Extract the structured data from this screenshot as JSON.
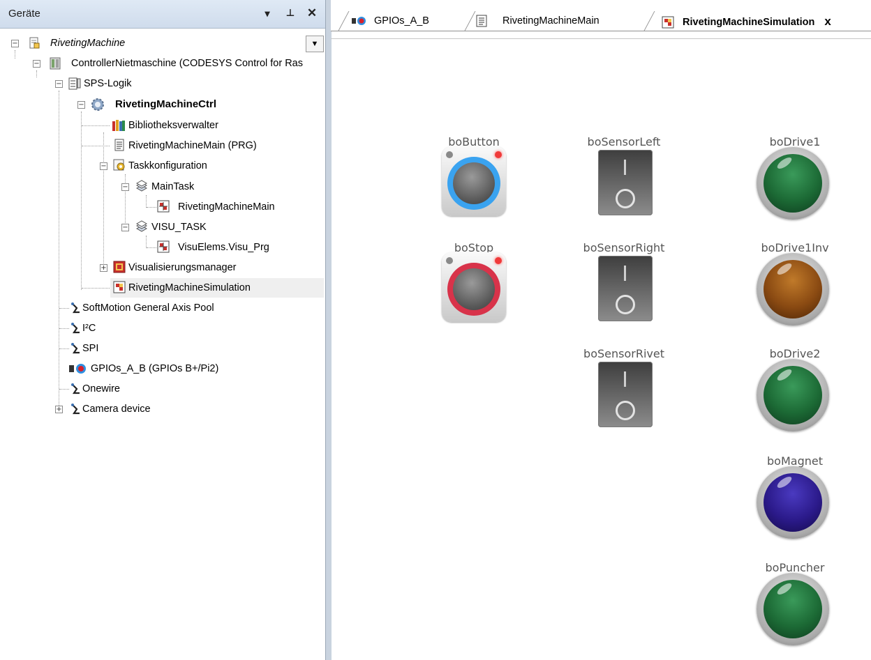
{
  "devices_panel": {
    "title": "Geräte",
    "pin_glyph": "ᵖ",
    "close_glyph": "✕",
    "dropdown_glyph": "▾"
  },
  "tree": {
    "items": [
      {
        "label": "RivetingMachine",
        "icon": "project-icon"
      },
      {
        "label": "ControllerNietmaschine (CODESYS Control for Ras",
        "icon": "controller-icon"
      },
      {
        "label": "SPS-Logik",
        "icon": "plc-logic-icon"
      },
      {
        "label": "RivetingMachineCtrl",
        "icon": "application-gear-icon"
      },
      {
        "label": "Bibliotheksverwalter",
        "icon": "library-icon"
      },
      {
        "label": "RivetingMachineMain (PRG)",
        "icon": "program-icon"
      },
      {
        "label": "Taskkonfiguration",
        "icon": "task-config-icon"
      },
      {
        "label": "MainTask",
        "icon": "task-icon"
      },
      {
        "label": "RivetingMachineMain",
        "icon": "task-call-icon"
      },
      {
        "label": "VISU_TASK",
        "icon": "task-icon"
      },
      {
        "label": "VisuElems.Visu_Prg",
        "icon": "task-call-icon"
      },
      {
        "label": "Visualisierungsmanager",
        "icon": "visu-manager-icon"
      },
      {
        "label": "RivetingMachineSimulation",
        "icon": "visualization-icon"
      },
      {
        "label": "SoftMotion General Axis Pool",
        "icon": "axis-pool-icon"
      },
      {
        "label": "I²C",
        "icon": "bus-icon"
      },
      {
        "label": "SPI",
        "icon": "bus-icon"
      },
      {
        "label": "GPIOs_A_B (GPIOs B+/Pi2)",
        "icon": "gpio-icon"
      },
      {
        "label": "Onewire",
        "icon": "bus-icon"
      },
      {
        "label": "Camera device",
        "icon": "bus-icon"
      }
    ]
  },
  "tabs": [
    {
      "label": "GPIOs_A_B",
      "icon": "gpio-icon"
    },
    {
      "label": "RivetingMachineMain",
      "icon": "program-icon"
    },
    {
      "label": "RivetingMachineSimulation",
      "icon": "visualization-icon",
      "active": true,
      "close": "x"
    }
  ],
  "visualization": {
    "push_buttons": [
      {
        "label": "boButton",
        "ring_color": "#3aa3f0"
      },
      {
        "label": "boStop",
        "ring_color": "#d8334a"
      }
    ],
    "switches": [
      {
        "label": "boSensorLeft"
      },
      {
        "label": "boSensorRight"
      },
      {
        "label": "boSensorRivet"
      }
    ],
    "lamps": [
      {
        "label": "boDrive1",
        "color": "#1c6a35"
      },
      {
        "label": "boDrive1Inv",
        "color": "#8a4a12"
      },
      {
        "label": "boDrive2",
        "color": "#1c6a35"
      },
      {
        "label": "boMagnet",
        "color": "#2b1a8a"
      },
      {
        "label": "boPuncher",
        "color": "#1c6a35"
      }
    ]
  }
}
